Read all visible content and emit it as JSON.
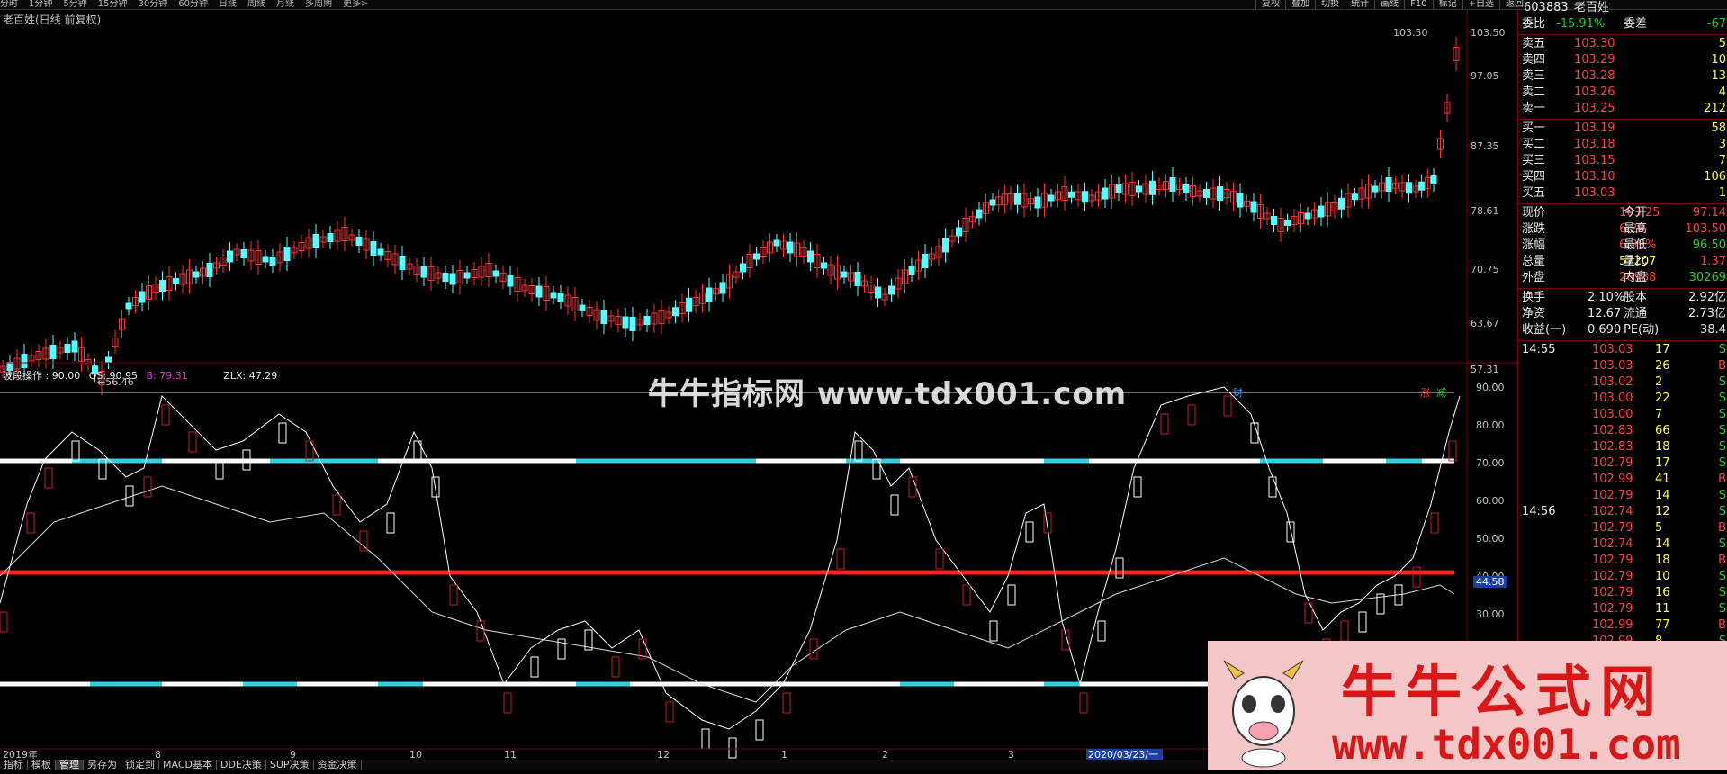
{
  "toolbar": {
    "periods": [
      "分时",
      "1分钟",
      "5分钟",
      "15分钟",
      "30分钟",
      "60分钟",
      "日线",
      "周线",
      "月线",
      "多周期",
      "更多>"
    ],
    "right_buttons": [
      "复权",
      "叠加",
      "切换",
      "统计",
      "画线",
      "F10",
      "标记",
      "+自选",
      "返回"
    ]
  },
  "chart": {
    "title": "老百姓(日线 前复权)",
    "price_labels": [
      "103.50",
      "97.05",
      "87.35",
      "78.61",
      "70.75",
      "63.67",
      "57.31"
    ],
    "high_marker": "103.50",
    "low_marker": "56.46",
    "event_markers": [
      "财",
      "涨",
      "减"
    ],
    "x_labels": [
      "2019年",
      "8",
      "9",
      "10",
      "11",
      "12",
      "1",
      "2",
      "3"
    ],
    "date_cursor": "2020/03/23/一"
  },
  "indicator": {
    "header_label": "波段操作",
    "header_value": "90.00",
    "qs_label": "QS",
    "qs_value": "90.95",
    "b_label": "B",
    "b_value": "79.31",
    "zlx_label": "ZLX",
    "zlx_value": "47.29",
    "y_labels": [
      "90.00",
      "80.00",
      "70.00",
      "60.00",
      "50.00",
      "40.00",
      "30.00"
    ],
    "current_value": "44.58"
  },
  "quote_panel": {
    "code": "603883",
    "name": "老百姓",
    "wb_label": "委比",
    "wb_value": "-15.91%",
    "wc_label": "委差",
    "wc_value": "-67",
    "asks": [
      {
        "label": "卖五",
        "price": "103.30",
        "vol": "5"
      },
      {
        "label": "卖四",
        "price": "103.29",
        "vol": "10"
      },
      {
        "label": "卖三",
        "price": "103.28",
        "vol": "13"
      },
      {
        "label": "卖二",
        "price": "103.26",
        "vol": "4"
      },
      {
        "label": "卖一",
        "price": "103.25",
        "vol": "212"
      }
    ],
    "bids": [
      {
        "label": "买一",
        "price": "103.19",
        "vol": "58"
      },
      {
        "label": "买二",
        "price": "103.18",
        "vol": "3"
      },
      {
        "label": "买三",
        "price": "103.15",
        "vol": "7"
      },
      {
        "label": "买四",
        "price": "103.10",
        "vol": "106"
      },
      {
        "label": "买五",
        "price": "103.03",
        "vol": "1"
      }
    ],
    "stats": [
      {
        "l1": "现价",
        "v1": "103.25",
        "l2": "今开",
        "v2": "97.14",
        "c1": "red",
        "c2": "red"
      },
      {
        "l1": "涨跌",
        "v1": "6.20",
        "l2": "最高",
        "v2": "103.50",
        "c1": "red",
        "c2": "red"
      },
      {
        "l1": "涨幅",
        "v1": "6.39%",
        "l2": "最低",
        "v2": "96.50",
        "c1": "red",
        "c2": "green"
      },
      {
        "l1": "总量",
        "v1": "57207",
        "l2": "量比",
        "v2": "1.37",
        "c1": "yellow",
        "c2": "red"
      },
      {
        "l1": "外盘",
        "v1": "26938",
        "l2": "内盘",
        "v2": "30269",
        "c1": "red",
        "c2": "green"
      }
    ],
    "stats2": [
      {
        "l1": "换手",
        "v1": "2.10%",
        "l2": "股本",
        "v2": "2.92亿"
      },
      {
        "l1": "净资",
        "v1": "12.67",
        "l2": "流通",
        "v2": "2.73亿"
      },
      {
        "l1": "收益(一)",
        "v1": "0.690",
        "l2": "PE(动)",
        "v2": "38.4"
      }
    ],
    "ticks": [
      {
        "time": "14:55",
        "price": "103.03",
        "vol": "17",
        "side": "S"
      },
      {
        "time": "",
        "price": "103.03",
        "vol": "26",
        "side": "B"
      },
      {
        "time": "",
        "price": "103.02",
        "vol": "2",
        "side": "S"
      },
      {
        "time": "",
        "price": "103.00",
        "vol": "22",
        "side": "S"
      },
      {
        "time": "",
        "price": "103.00",
        "vol": "7",
        "side": "S"
      },
      {
        "time": "",
        "price": "102.83",
        "vol": "66",
        "side": "S"
      },
      {
        "time": "",
        "price": "102.83",
        "vol": "18",
        "side": "S"
      },
      {
        "time": "",
        "price": "102.79",
        "vol": "17",
        "side": "S"
      },
      {
        "time": "",
        "price": "102.99",
        "vol": "41",
        "side": "B"
      },
      {
        "time": "",
        "price": "102.79",
        "vol": "14",
        "side": "S"
      },
      {
        "time": "14:56",
        "price": "102.74",
        "vol": "12",
        "side": "S"
      },
      {
        "time": "",
        "price": "102.79",
        "vol": "5",
        "side": "B"
      },
      {
        "time": "",
        "price": "102.74",
        "vol": "14",
        "side": "S"
      },
      {
        "time": "",
        "price": "102.79",
        "vol": "18",
        "side": "B"
      },
      {
        "time": "",
        "price": "102.79",
        "vol": "10",
        "side": "S"
      },
      {
        "time": "",
        "price": "102.79",
        "vol": "16",
        "side": "S"
      },
      {
        "time": "",
        "price": "102.79",
        "vol": "11",
        "side": "S"
      },
      {
        "time": "",
        "price": "102.99",
        "vol": "77",
        "side": "B"
      },
      {
        "time": "",
        "price": "102.99",
        "vol": "8",
        "side": "S"
      }
    ]
  },
  "bottom_tabs": [
    "指标",
    "模板",
    "管理",
    "另存为",
    "锁定到",
    "MACD基本",
    "DDE决策",
    "SUP决策",
    "资金决策"
  ],
  "watermarks": {
    "center": "牛牛指标网 www.tdx001.com",
    "logo_cn": "牛牛公式网",
    "logo_url": "www.tdx001.com"
  },
  "colors": {
    "up": "#ff3030",
    "down": "#54ffff",
    "panel_border": "#770000"
  }
}
